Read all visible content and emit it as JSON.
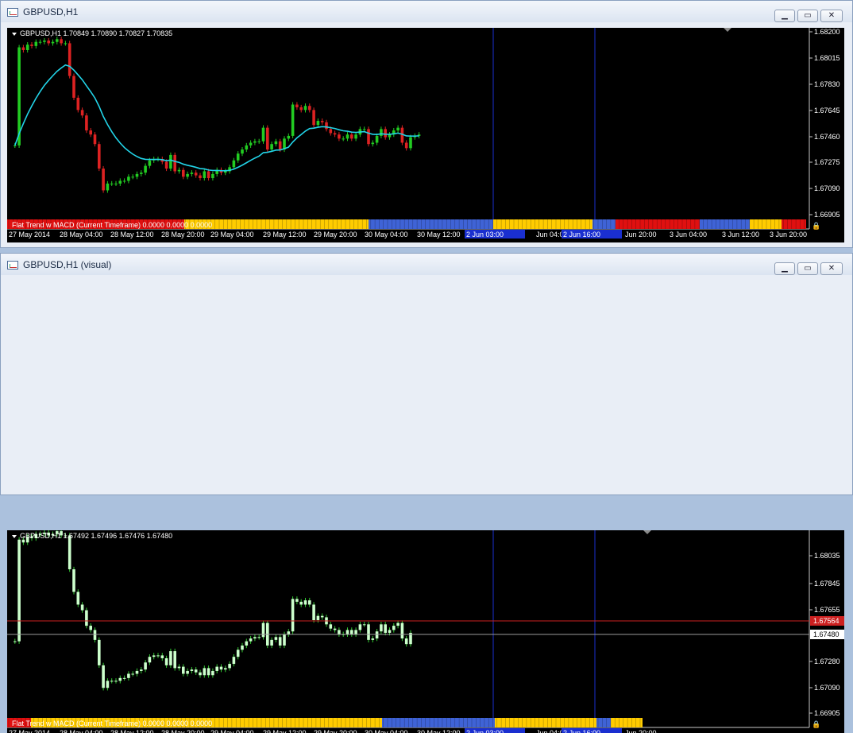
{
  "colors": {
    "bull": "#22cc22",
    "bear": "#dd2222",
    "ma": "#22d4e8",
    "text": "#ffffff",
    "grid": "#c8c8c8",
    "trend_yellow": "#ffcc00",
    "trend_blue": "#3f63d6",
    "trend_red": "#e01010",
    "vline": "#1a2fd0",
    "ask_line": "#cc2020",
    "bid_line": "#9a9a9a",
    "visual_candle": "#ccffcc",
    "visual_wick": "#33cc33"
  },
  "window1": {
    "title": "GBPUSD,H1",
    "buttons": {
      "minimize": "▁",
      "maximize": "▭",
      "close": "✕"
    },
    "chart": {
      "header_symbol": "GBPUSD,H1",
      "header_ohlc": "1.70849 1.70890 1.70827 1.70835",
      "price_labels": [
        "1.68200",
        "1.68015",
        "1.67830",
        "1.67645",
        "1.67460",
        "1.67275",
        "1.67090",
        "1.66905"
      ],
      "time_labels": [
        "27 May 2014",
        "28 May 04:00",
        "28 May 12:00",
        "28 May 20:00",
        "29 May 04:00",
        "29 May 12:00",
        "29 May 20:00",
        "30 May 04:00",
        "30 May 12:00",
        "2 Jun 03:00",
        "Jun 04:00",
        "2 Jun 16:00",
        "Jun 20:00",
        "3 Jun 04:00",
        "3 Jun 12:00",
        "3 Jun 20:00"
      ],
      "highlight_labels": [
        "2 Jun 03:00",
        "2 Jun 16:00"
      ],
      "indicator_label": "Flat Trend w MACD (Current Timeframe) 0.0000 0.0000 0.0000",
      "lock_icon": "🔒"
    }
  },
  "window2": {
    "title": "GBPUSD,H1 (visual)",
    "buttons": {
      "minimize": "▁",
      "maximize": "▭",
      "close": "✕"
    },
    "chart": {
      "header_symbol": "GBPUSD,H1",
      "header_ohlc": "1.67492 1.67496 1.67476 1.67480",
      "price_labels": [
        "1.68035",
        "1.67845",
        "1.67655",
        "1.67280",
        "1.67090",
        "1.66905"
      ],
      "ask_label": "1.67564",
      "bid_label": "1.67480",
      "time_labels": [
        "27 May 2014",
        "28 May 04:00",
        "28 May 12:00",
        "28 May 20:00",
        "29 May 04:00",
        "29 May 12:00",
        "29 May 20:00",
        "30 May 04:00",
        "30 May 12:00",
        "2 Jun 03:00",
        "Jun 04:00",
        "2 Jun 16:00",
        "Jun 20:00"
      ],
      "highlight_labels": [
        "2 Jun 03:00",
        "2 Jun 16:00"
      ],
      "indicator_label": "Flat Trend w MACD (Current Timeframe) 0.0000 0.0000 0.0000",
      "lock_icon": "🔒"
    }
  },
  "chart_data": {
    "type": "candlestick",
    "symbol": "GBPUSD",
    "timeframe": "H1",
    "closes": [
      1.674,
      1.6812,
      1.681,
      1.6814,
      1.6813,
      1.6816,
      1.6816,
      1.6817,
      1.6815,
      1.6816,
      1.6818,
      1.6815,
      1.6815,
      1.6791,
      1.6775,
      1.6766,
      1.6762,
      1.6751,
      1.6748,
      1.6741,
      1.6723,
      1.6707,
      1.6712,
      1.6712,
      1.6712,
      1.6714,
      1.6714,
      1.6717,
      1.6717,
      1.6719,
      1.672,
      1.6725,
      1.6729,
      1.673,
      1.673,
      1.6728,
      1.6723,
      1.6733,
      1.6721,
      1.6722,
      1.6717,
      1.6719,
      1.672,
      1.6718,
      1.6716,
      1.6721,
      1.6716,
      1.6719,
      1.6722,
      1.672,
      1.6721,
      1.6724,
      1.6729,
      1.6734,
      1.6737,
      1.674,
      1.6742,
      1.6743,
      1.6743,
      1.6753,
      1.6737,
      1.6741,
      1.6743,
      1.6737,
      1.6745,
      1.6747,
      1.677,
      1.6768,
      1.6766,
      1.6769,
      1.6766,
      1.6755,
      1.6758,
      1.6757,
      1.6752,
      1.6749,
      1.6748,
      1.6745,
      1.6745,
      1.6748,
      1.6745,
      1.6748,
      1.6752,
      1.6752,
      1.6741,
      1.6742,
      1.6747,
      1.6752,
      1.6746,
      1.6748,
      1.6751,
      1.6753,
      1.6742,
      1.6738,
      1.6746,
      1.6747,
      1.6748
    ]
  }
}
